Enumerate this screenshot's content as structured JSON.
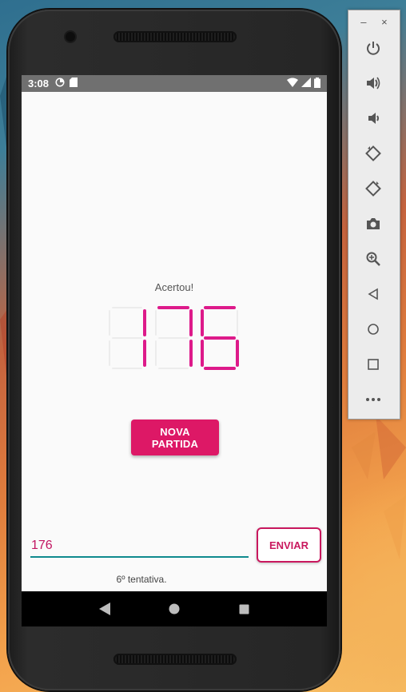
{
  "status_bar": {
    "time": "3:08"
  },
  "game": {
    "message": "Acertou!",
    "number": "176",
    "digit_color": "#dd1a8a",
    "new_game_label": "NOVA PARTIDA",
    "guess_value": "176",
    "send_label": "ENVIAR",
    "attempt_text": "6º tentativa."
  },
  "nav_bar": {
    "icons": [
      "back-icon",
      "home-icon",
      "recents-icon"
    ]
  },
  "emulator_panel": {
    "window_controls": {
      "minimize": "–",
      "close": "×"
    },
    "tools": [
      "power-icon",
      "volume-up-icon",
      "volume-down-icon",
      "rotate-left-icon",
      "rotate-right-icon",
      "camera-icon",
      "zoom-icon",
      "back-icon",
      "home-icon",
      "overview-icon",
      "more-icon"
    ]
  },
  "colors": {
    "accent": "#dd1866",
    "input_line": "#0f8a8e",
    "input_text": "#c21561"
  }
}
